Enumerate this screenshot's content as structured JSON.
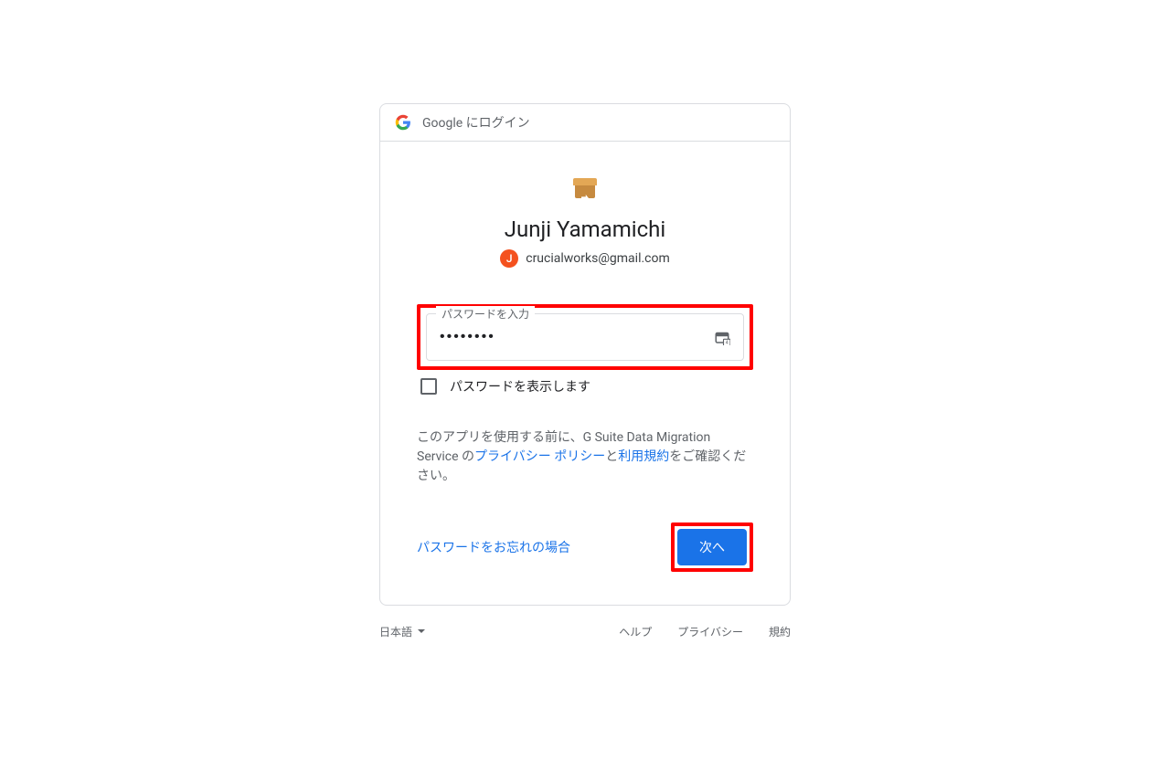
{
  "header": {
    "login_text": "Google にログイン"
  },
  "user": {
    "name": "Junji Yamamichi",
    "avatar_initial": "J",
    "email": "crucialworks@gmail.com"
  },
  "password": {
    "label": "パスワードを入力",
    "value": "••••••••",
    "show_label": "パスワードを表示します"
  },
  "disclaimer": {
    "prefix": "このアプリを使用する前に、G Suite Data Migration Service の",
    "privacy_link": "プライバシー ポリシー",
    "and": "と",
    "terms_link": "利用規約",
    "suffix": "をご確認ください。"
  },
  "actions": {
    "forgot": "パスワードをお忘れの場合",
    "next": "次へ"
  },
  "footer": {
    "language": "日本語",
    "help": "ヘルプ",
    "privacy": "プライバシー",
    "terms": "規約"
  }
}
